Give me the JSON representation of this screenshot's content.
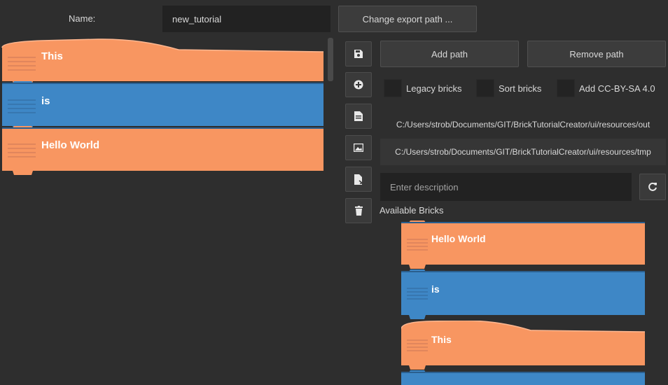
{
  "form": {
    "name_label": "Name:",
    "name_value": "new_tutorial",
    "change_export_label": "Change export path ..."
  },
  "toolbar": {
    "add_path_label": "Add path",
    "remove_path_label": "Remove path",
    "icons": [
      "save-icon",
      "add-circle-icon",
      "document-icon",
      "image-icon",
      "export-document-icon",
      "trash-icon"
    ]
  },
  "options": {
    "legacy_label": "Legacy bricks",
    "sort_label": "Sort bricks",
    "license_label": "Add CC-BY-SA 4.0"
  },
  "paths": {
    "out": "C:/Users/strob/Documents/GIT/BrickTutorialCreator/ui/resources/out",
    "tmp": "C:/Users/strob/Documents/GIT/BrickTutorialCreator/ui/resources/tmp"
  },
  "description": {
    "placeholder": "Enter description"
  },
  "available": {
    "title": "Available Bricks"
  },
  "tutorial_bricks": [
    {
      "text": "This",
      "color": "#f89661",
      "kind": "hat"
    },
    {
      "text": "is",
      "color": "#3e87c6",
      "kind": "stack"
    },
    {
      "text": "Hello World",
      "color": "#f89661",
      "kind": "stack"
    }
  ],
  "available_bricks": [
    {
      "text": "Hello World",
      "color": "#f89661",
      "kind": "stack"
    },
    {
      "text": "is",
      "color": "#3e87c6",
      "kind": "stack"
    },
    {
      "text": "This",
      "color": "#f89661",
      "kind": "hat"
    },
    {
      "text": "",
      "color": "#3e87c6",
      "kind": "stack"
    }
  ],
  "colors": {
    "orange": "#f89661",
    "blue": "#3e87c6",
    "background": "#2e2e2e"
  }
}
